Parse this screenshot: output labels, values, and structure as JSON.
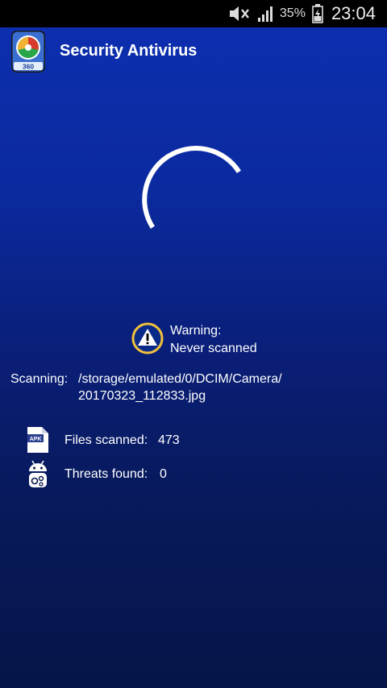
{
  "status_bar": {
    "battery_percent": "35%",
    "time": "23:04",
    "icons": [
      "mute-icon",
      "signal-icon",
      "battery-icon"
    ]
  },
  "app_bar": {
    "title": "Security Antivirus",
    "icon": "app-logo-360"
  },
  "spinner": {
    "icon": "loading-spinner"
  },
  "warning": {
    "icon": "warning-triangle-icon",
    "line1": "Warning:",
    "line2": "Never scanned"
  },
  "scan": {
    "label": "Scanning:",
    "path_line1": "/storage/emulated/0/DCIM/Camera/",
    "path_line2": "20170323_112833.jpg"
  },
  "stats": {
    "files": {
      "icon": "apk-file-icon",
      "label": "Files scanned:",
      "value": "473"
    },
    "threats": {
      "icon": "android-bug-icon",
      "label": "Threats found:",
      "value": "0"
    }
  }
}
